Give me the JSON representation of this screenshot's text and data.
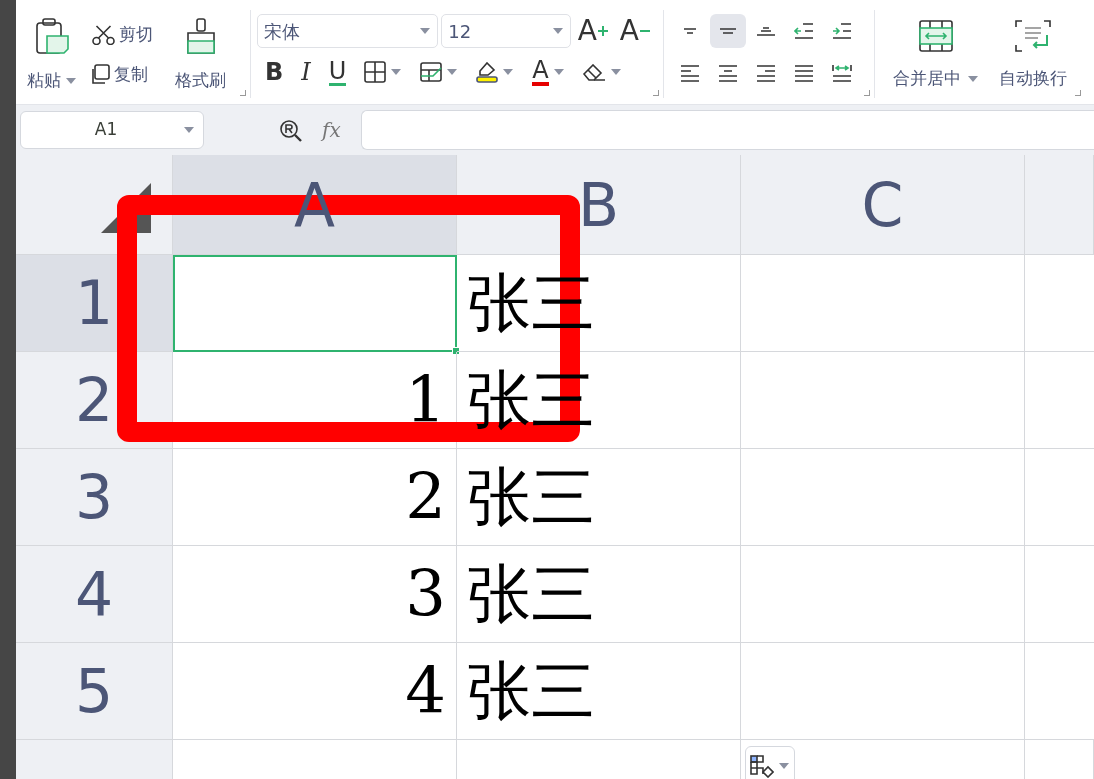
{
  "ribbon": {
    "clipboard": {
      "paste": "粘贴",
      "cut": "剪切",
      "copy": "复制",
      "format_painter": "格式刷"
    },
    "font": {
      "family": "宋体",
      "size": "12",
      "grow": "A",
      "shrink": "A",
      "bold": "B",
      "italic": "I",
      "underline": "U",
      "font_color": "A"
    },
    "alignment": [
      {
        "kind": "top",
        "selected": false
      },
      {
        "kind": "middle",
        "selected": true
      },
      {
        "kind": "bottom",
        "selected": false
      },
      {
        "kind": "outdent",
        "selected": false
      },
      {
        "kind": "indent",
        "selected": false
      },
      {
        "kind": "left",
        "selected": false
      },
      {
        "kind": "center",
        "selected": false
      },
      {
        "kind": "right",
        "selected": false
      },
      {
        "kind": "justify",
        "selected": false
      },
      {
        "kind": "distributed",
        "selected": false
      }
    ],
    "merge_center": "合并居中",
    "wrap_text": "自动换行"
  },
  "formula_bar": {
    "name_box": "A1",
    "function_label": "fx"
  },
  "sheet": {
    "columns": [
      {
        "label": "A",
        "selected": true
      },
      {
        "label": "B",
        "selected": false
      },
      {
        "label": "C",
        "selected": false
      }
    ],
    "rows": [
      {
        "label": "1",
        "selected": true,
        "cells": [
          {
            "selected": true
          },
          {
            "value": "张三",
            "selected": false
          }
        ]
      },
      {
        "label": "2",
        "selected": false,
        "cells": [
          {
            "value": "1",
            "selected": false
          },
          {
            "value": "张三",
            "selected": false
          }
        ]
      },
      {
        "label": "3",
        "selected": false,
        "cells": [
          {
            "value": "2",
            "selected": false
          },
          {
            "value": "张三",
            "selected": false
          }
        ]
      },
      {
        "label": "4",
        "selected": false,
        "cells": [
          {
            "value": "3",
            "selected": false
          },
          {
            "value": "张三",
            "selected": false
          }
        ]
      },
      {
        "label": "5",
        "selected": false,
        "cells": [
          {
            "value": "4",
            "selected": false
          },
          {
            "value": "张三",
            "selected": false
          }
        ]
      }
    ]
  },
  "annotation": {
    "kind": "rectangle"
  }
}
